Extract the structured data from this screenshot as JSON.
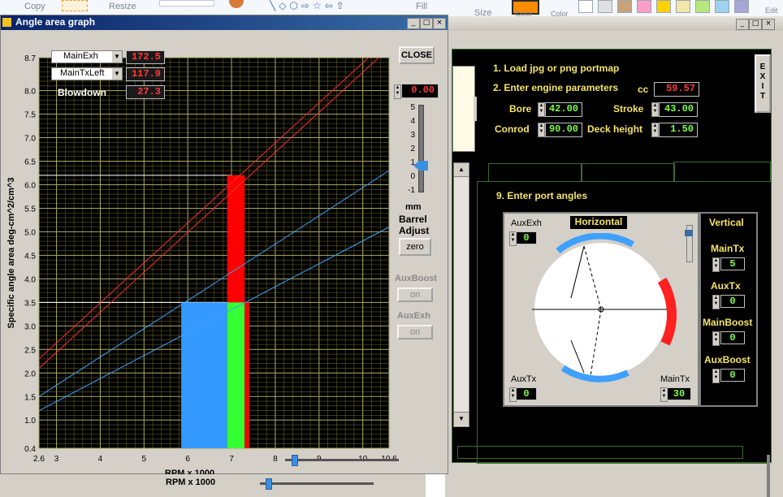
{
  "paint_toolbar": {
    "copy_label": "Copy",
    "resize_label": "Resize",
    "fill_label": "Fill",
    "size_label": "Size",
    "color1_label": "Color",
    "color2_label": "Color",
    "edit_label": "Edit"
  },
  "back_window": {
    "steps": {
      "step1": "1. Load jpg or png portmap",
      "step2": "2. Enter engine parameters",
      "step9": "9. Enter port angles"
    },
    "cc_label": "cc",
    "cc_value": "59.57",
    "bore_label": "Bore",
    "bore_value": "42.00",
    "stroke_label": "Stroke",
    "stroke_value": "43.00",
    "conrod_label": "Conrod",
    "conrod_value": "90.00",
    "deck_label": "Deck height",
    "deck_value": "1.50",
    "exit_label": "E\nX\nI\nT",
    "horizontal_label": "Horizontal",
    "vertical_label": "Vertical",
    "auxexh_label": "AuxExh",
    "auxexh_value": "0",
    "auxtx_left_label": "AuxTx",
    "auxtx_left_value": "0",
    "maintx_bottom_label": "MainTx",
    "maintx_bottom_value": "30",
    "maintx_label": "MainTx",
    "maintx_value": "5",
    "auxtx_label": "AuxTx",
    "auxtx_value": "0",
    "mainboost_label": "MainBoost",
    "mainboost_value": "0",
    "auxboost_label": "AuxBoost",
    "auxboost_value": "0"
  },
  "front_window": {
    "title": "Angle area graph",
    "close_label": "CLOSE",
    "dropdown1": "MainExh",
    "dropdown1_value": "172.5",
    "dropdown2": "MainTxLeft",
    "dropdown2_value": "117.9",
    "blowdown_label": "Blowdown",
    "blowdown_value": "27.3",
    "barrel_value": "0.00",
    "barrel_label_mm": "mm",
    "barrel_label_barrel": "Barrel",
    "barrel_label_adjust": "Adjust",
    "zero_label": "zero",
    "auxboost_label": "AuxBoost",
    "auxboost_toggle": "on",
    "auxexh_label": "AuxExh",
    "auxexh_toggle": "on",
    "slider_ticks": [
      "5",
      "4",
      "3",
      "2",
      "1",
      "0",
      "-1"
    ]
  },
  "bottom_strip": {
    "rpm_label": "RPM x 1000"
  },
  "chart_data": {
    "type": "line",
    "xlabel": "RPM x 1000",
    "ylabel": "Specific angle area  deg-cm^2/cm^3",
    "xticks": [
      "2.6",
      "3",
      "4",
      "5",
      "6",
      "7",
      "8",
      "9",
      "10",
      "10.6"
    ],
    "yticks": [
      "0.4",
      "1.0",
      "1.5",
      "2.0",
      "2.5",
      "3.0",
      "3.5",
      "4.0",
      "4.5",
      "5.0",
      "5.5",
      "6.0",
      "6.5",
      "7.0",
      "7.5",
      "8.0",
      "8.7"
    ],
    "xlim": [
      2.6,
      10.6
    ],
    "ylim": [
      0.4,
      8.7
    ],
    "grid": true,
    "lines": [
      {
        "color": "#ff2a2a",
        "x": [
          2.6,
          10.6
        ],
        "y": [
          2.3,
          9.1
        ]
      },
      {
        "color": "#ff2a2a",
        "x": [
          2.6,
          10.6
        ],
        "y": [
          2.1,
          8.9
        ]
      },
      {
        "color": "#3fa0ff",
        "x": [
          2.6,
          10.6
        ],
        "y": [
          1.5,
          6.3
        ]
      },
      {
        "color": "#3fa0ff",
        "x": [
          2.6,
          10.6
        ],
        "y": [
          1.2,
          5.1
        ]
      }
    ],
    "bars": [
      {
        "color": "#3399ff",
        "x0": 5.85,
        "x1": 6.9,
        "y": 3.5
      },
      {
        "color": "#33ff33",
        "x0": 6.9,
        "x1": 7.3,
        "y": 3.5
      },
      {
        "color": "#ff0000",
        "x0": 6.9,
        "x1": 7.3,
        "y": 6.2,
        "y0": 3.5
      },
      {
        "color": "#ff0000",
        "x0": 7.3,
        "x1": 7.4,
        "y": 3.5
      }
    ],
    "reflines": [
      {
        "color": "#ffffff",
        "y": 6.2
      },
      {
        "color": "#ffffff",
        "y": 3.5
      }
    ]
  }
}
